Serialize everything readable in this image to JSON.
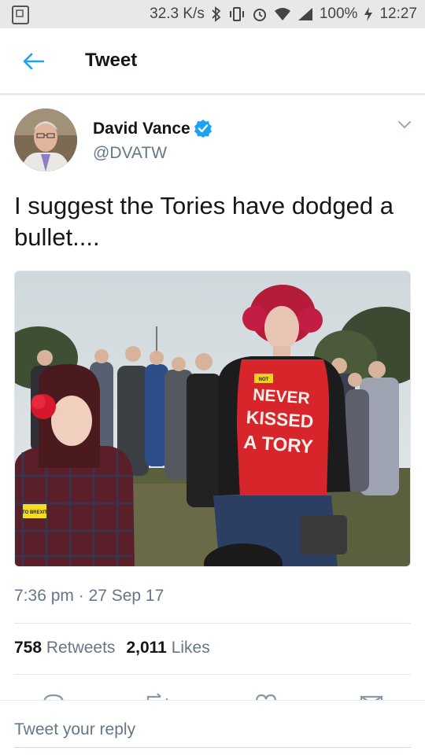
{
  "status_bar": {
    "network_speed": "32.3 K/s",
    "battery": "100%",
    "time": "12:27"
  },
  "header": {
    "title": "Tweet"
  },
  "tweet": {
    "author": {
      "name": "David Vance",
      "handle": "@DVATW",
      "verified": true
    },
    "text": "I suggest the Tories have dodged a bullet....",
    "photo": {
      "shirt_text": [
        "NEVER",
        "KISSED",
        "A TORY"
      ],
      "badge_text": [
        "NOT",
        "TO BREXIT"
      ]
    },
    "timestamp": "7:36 pm · 27 Sep 17",
    "stats": {
      "retweets_count": "758",
      "retweets_label": "Retweets",
      "likes_count": "2,011",
      "likes_label": "Likes"
    }
  },
  "reply": {
    "placeholder": "Tweet your reply"
  },
  "colors": {
    "accent": "#1da1f2",
    "verified": "#1da1f2",
    "secondary_text": "#657786",
    "shirt_red": "#d8252c"
  }
}
